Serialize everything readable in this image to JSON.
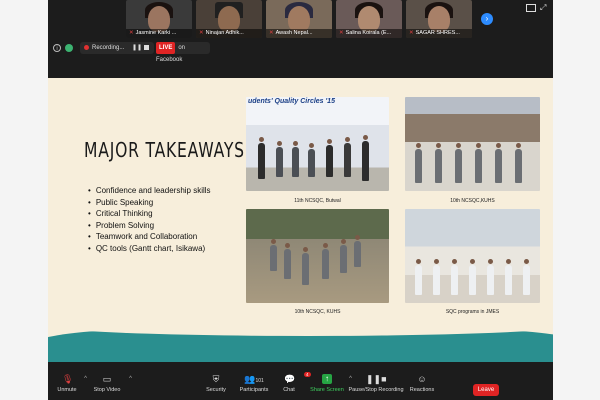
{
  "participants": [
    {
      "name": "Jasmine Karki ...",
      "active": false
    },
    {
      "name": "Ninajan Adhik...",
      "active": false
    },
    {
      "name": "Awash Nepal...",
      "active": false
    },
    {
      "name": "Salina Koirala (E...",
      "active": false
    },
    {
      "name": "SAGAR SHRES...",
      "active": false
    }
  ],
  "status": {
    "recording_label": "Recording...",
    "live_label": "LIVE",
    "live_platform": "on Facebook"
  },
  "slide": {
    "title": "MAJOR TAKEAWAYS",
    "takeaways": [
      "Confidence and leadership skills",
      "Public Speaking",
      "Critical Thinking",
      "Problem Solving",
      "Teamwork and Collaboration",
      "QC tools (Gantt chart, Isikawa)"
    ],
    "photos": [
      {
        "caption": "11th NCSQC, Butwal",
        "banner": "udents' Quality Circles '15"
      },
      {
        "caption": "10th NCSQC,KUHS"
      },
      {
        "caption": "10th NCSQC, KUHS"
      },
      {
        "caption": "SQC programs in JMES"
      }
    ]
  },
  "toolbar": {
    "unmute": "Unmute",
    "stop_video": "Stop Video",
    "security": "Security",
    "participants": "Participants",
    "participants_count": "101",
    "chat": "Chat",
    "chat_badge": "4",
    "share_screen": "Share Screen",
    "pause_stop_recording": "Pause/Stop Recording",
    "reactions": "Reactions",
    "leave": "Leave"
  },
  "colors": {
    "accent_green": "#26a544",
    "leave_red": "#e02424",
    "slide_bg": "#f7eedb",
    "wave_teal": "#2a8f8f"
  }
}
